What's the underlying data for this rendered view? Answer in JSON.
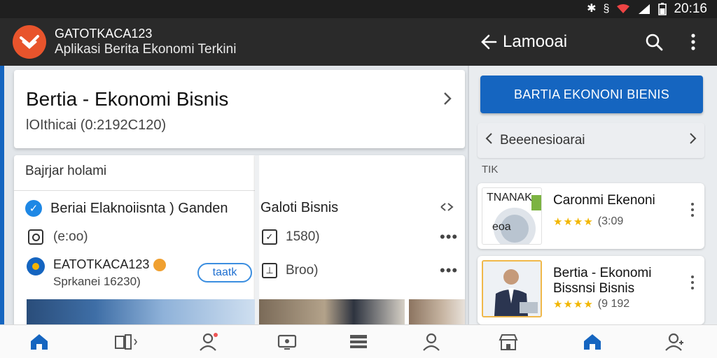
{
  "status_bar": {
    "icons": [
      "bluetooth-icon",
      "vibrate-icon",
      "wifi-icon",
      "signal-icon",
      "battery-icon"
    ],
    "time": "20:16"
  },
  "app_bar": {
    "title": "GATOTKACA123",
    "subtitle": "Aplikasi Berita Ekonomi Terkini"
  },
  "right_bar": {
    "title": "Lamooai"
  },
  "hero": {
    "title": "Bertia - Ekonomi Bisnis",
    "subtitle": "lOIthicai (0:2192C120)"
  },
  "feed": {
    "header": "Bajrjar holami",
    "rows": [
      {
        "title": "Beriai Elaknoiisnta ) Ganden"
      },
      {
        "meta": "(e:oo)"
      },
      {
        "name": "EATOTKACA123",
        "sub": "Sprkanei 16230)",
        "pill": "taatk"
      }
    ],
    "col2": {
      "title": "Galoti Bisnis",
      "row1": "1580)",
      "row2": "Broo)"
    }
  },
  "cta": {
    "label": "BARTIA EKONONI BIENIS"
  },
  "pager": {
    "label": "Beeenesioarai"
  },
  "section_label": "TIK",
  "cards": [
    {
      "title": "Caronmi Ekenoni",
      "rating": "(3:09",
      "stars": "★★★★",
      "img_text_top": "TNANAK",
      "img_text_bottom": "eoa"
    },
    {
      "title": "Bertia - Ekonomi Bissnsi Bisnis",
      "rating": "(9 192",
      "stars": "★★★★"
    }
  ],
  "colors": {
    "accent": "#1565c0",
    "logo": "#e8542c",
    "bar": "#2a2a2a",
    "star": "#f2b600"
  }
}
